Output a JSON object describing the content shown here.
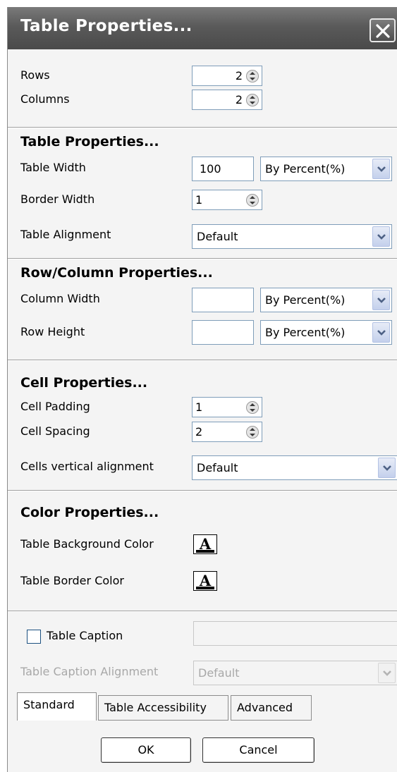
{
  "window": {
    "title": "Table Properties..."
  },
  "size": {
    "rows_label": "Rows",
    "rows_value": "2",
    "columns_label": "Columns",
    "columns_value": "2"
  },
  "table_props": {
    "header": "Table Properties...",
    "width_label": "Table Width",
    "width_value": "100",
    "width_unit": "By Percent(%)",
    "border_label": "Border Width",
    "border_value": "1",
    "alignment_label": "Table Alignment",
    "alignment_value": "Default"
  },
  "rowcol_props": {
    "header": "Row/Column Properties...",
    "col_width_label": "Column Width",
    "col_width_value": "",
    "col_width_unit": "By Percent(%)",
    "row_height_label": "Row Height",
    "row_height_value": "",
    "row_height_unit": "By Percent(%)"
  },
  "cell_props": {
    "header": "Cell Properties...",
    "padding_label": "Cell Padding",
    "padding_value": "1",
    "spacing_label": "Cell Spacing",
    "spacing_value": "2",
    "valign_label": "Cells vertical alignment",
    "valign_value": "Default"
  },
  "color_props": {
    "header": "Color Properties...",
    "bg_label": "Table Background Color",
    "border_label": "Table Border Color",
    "button_glyph": "A"
  },
  "caption": {
    "checkbox_label": "Table Caption",
    "checked": false,
    "value": "",
    "alignment_label": "Table Caption Alignment",
    "alignment_value": "Default"
  },
  "tabs": [
    "Standard",
    "Table Accessibility",
    "Advanced"
  ],
  "buttons": {
    "ok": "OK",
    "cancel": "Cancel"
  }
}
